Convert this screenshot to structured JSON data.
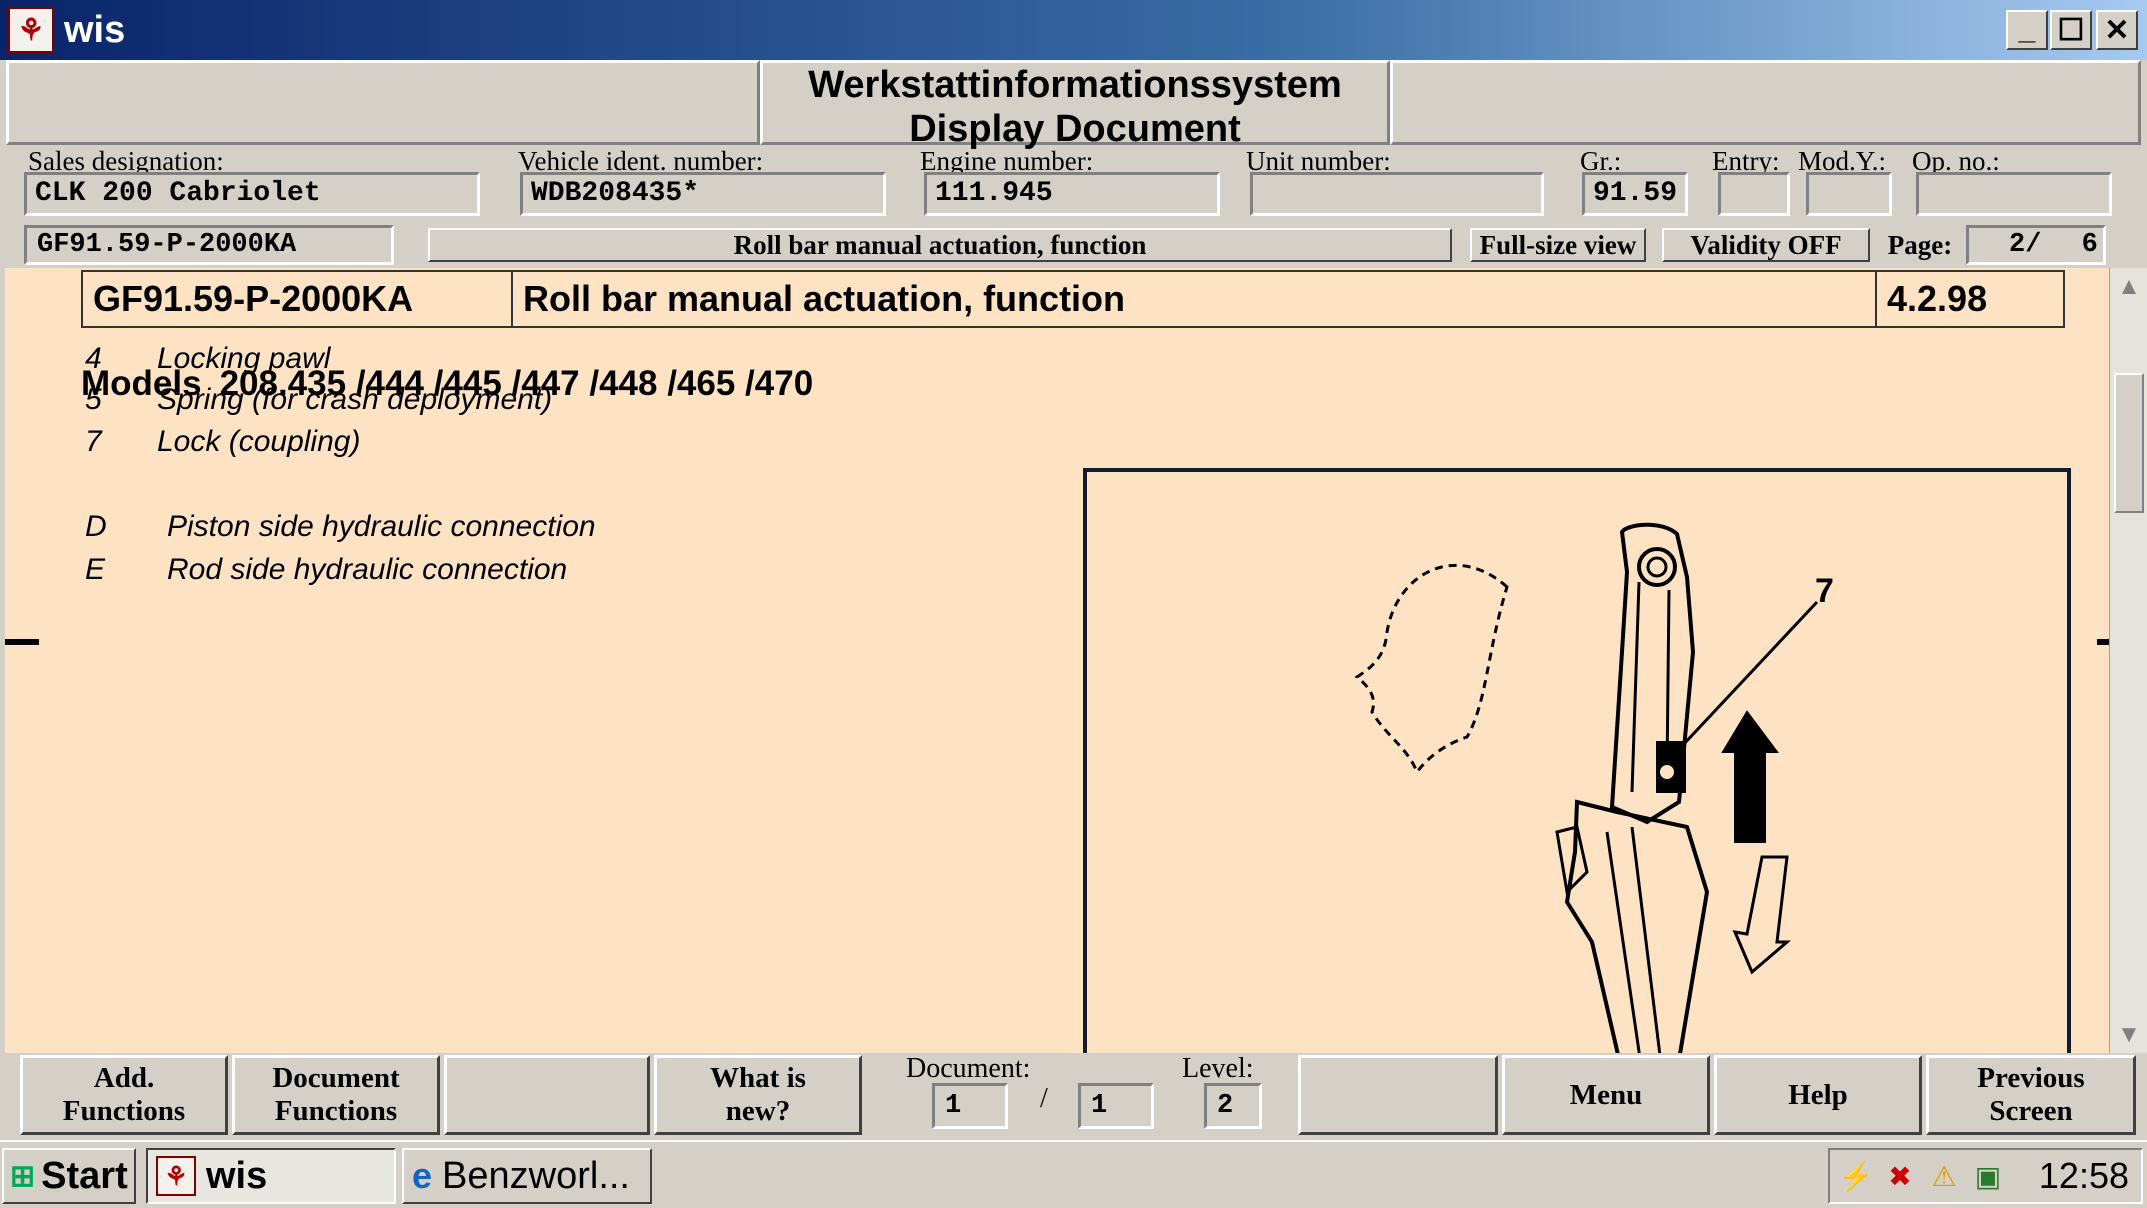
{
  "window": {
    "title": "wis"
  },
  "header": {
    "system_name": "Werkstattinformationssystem",
    "subtitle": "Display Document"
  },
  "vehicle": {
    "sales_designation": {
      "label": "Sales designation:",
      "value": "CLK 200 Cabriolet"
    },
    "vin": {
      "label": "Vehicle ident. number:",
      "value": "WDB208435*"
    },
    "engine": {
      "label": "Engine number:",
      "value": "111.945"
    },
    "unit": {
      "label": "Unit number:",
      "value": ""
    },
    "group": {
      "label": "Gr.:",
      "value": "91.59"
    },
    "entry": {
      "label": "Entry:",
      "value": ""
    },
    "model_year": {
      "label": "Mod.Y.:",
      "value": ""
    },
    "op_no": {
      "label": "Op. no.:",
      "value": ""
    }
  },
  "docline": {
    "code": "GF91.59-P-2000KA",
    "title": "Roll bar manual actuation, function",
    "full_size_label": "Full-size view",
    "validity_label": "Validity OFF",
    "page_label": "Page:",
    "page_current": "2/",
    "page_total": "6"
  },
  "document": {
    "code": "GF91.59-P-2000KA",
    "title": "Roll bar manual actuation, function",
    "date": "4.2.98",
    "models_label": "Models",
    "models_values": "208.435 /444 /445 /447 /448 /465 /470",
    "legend": [
      {
        "key": "4",
        "text": "Locking pawl"
      },
      {
        "key": "5",
        "text": "Spring (for crash deployment)"
      },
      {
        "key": "7",
        "text": "Lock (coupling)"
      }
    ],
    "connections": [
      {
        "key": "D",
        "text": "Piston side hydraulic connection"
      },
      {
        "key": "E",
        "text": "Rod side hydraulic connection"
      }
    ],
    "figure_callout": "7"
  },
  "bottom": {
    "add_functions": "Add. Functions",
    "add_functions_l1": "Add.",
    "add_functions_l2": "Functions",
    "document_functions_l1": "Document",
    "document_functions_l2": "Functions",
    "whats_new_l1": "What is",
    "whats_new_l2": "new?",
    "document_label": "Document:",
    "document_current": "1",
    "document_sep": "/",
    "document_total": "1",
    "level_label": "Level:",
    "level_value": "2",
    "menu": "Menu",
    "help": "Help",
    "previous_l1": "Previous",
    "previous_l2": "Screen"
  },
  "taskbar": {
    "start": "Start",
    "tasks": [
      "wis",
      "Benzworl..."
    ],
    "clock": "12:58"
  }
}
